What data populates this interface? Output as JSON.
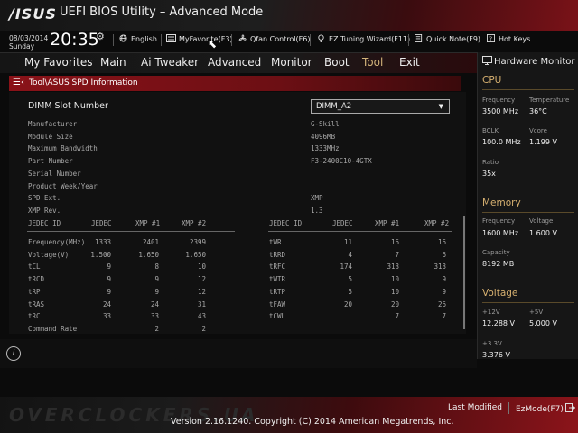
{
  "header": {
    "logo": "/ISUS",
    "title": "UEFI BIOS Utility – Advanced Mode",
    "date": "08/03/2014",
    "day": "Sunday",
    "time": "20:35"
  },
  "toolbar": {
    "language": "English",
    "myfavorite": "MyFavorite(F3)",
    "qfan": "Qfan Control(F6)",
    "ez_tuning": "EZ Tuning Wizard(F11)",
    "quick_note": "Quick Note(F9)",
    "hot_keys": "Hot Keys"
  },
  "menu": {
    "items": [
      "My Favorites",
      "Main",
      "Ai Tweaker",
      "Advanced",
      "Monitor",
      "Boot",
      "Tool",
      "Exit"
    ],
    "active": "Tool"
  },
  "breadcrumb": "Tool\\ASUS SPD Information",
  "spd": {
    "slot_label": "DIMM Slot Number",
    "slot_value": "DIMM_A2",
    "info_labels": [
      "Manufacturer",
      "Module Size",
      "Maximum Bandwidth",
      "Part Number",
      "Serial Number",
      "Product Week/Year",
      "SPD Ext.",
      "XMP Rev."
    ],
    "info_values": [
      "G-Skill",
      "4096MB",
      "1333MHz",
      "F3-2400C10-4GTX",
      "",
      "",
      "XMP",
      "1.3"
    ],
    "left_headers": [
      "JEDEC ID",
      "JEDEC",
      "XMP #1",
      "XMP #2"
    ],
    "right_headers": [
      "JEDEC ID",
      "JEDEC",
      "XMP #1",
      "XMP #2"
    ],
    "left_rows": [
      [
        "Frequency(MHz)",
        "1333",
        "2401",
        "2399"
      ],
      [
        "Voltage(V)",
        "1.500",
        "1.650",
        "1.650"
      ],
      [
        "tCL",
        "9",
        "8",
        "10"
      ],
      [
        "tRCD",
        "9",
        "9",
        "12"
      ],
      [
        "tRP",
        "9",
        "9",
        "12"
      ],
      [
        "tRAS",
        "24",
        "24",
        "31"
      ],
      [
        "tRC",
        "33",
        "33",
        "43"
      ],
      [
        "Command Rate",
        "",
        "2",
        "2"
      ]
    ],
    "right_rows": [
      [
        "tWR",
        "11",
        "16",
        "16"
      ],
      [
        "tRRD",
        "4",
        "7",
        "6"
      ],
      [
        "tRFC",
        "174",
        "313",
        "313"
      ],
      [
        "tWTR",
        "5",
        "10",
        "9"
      ],
      [
        "tRTP",
        "5",
        "10",
        "9"
      ],
      [
        "tFAW",
        "20",
        "20",
        "26"
      ],
      [
        "tCWL",
        "",
        "7",
        "7"
      ]
    ]
  },
  "hw_monitor": {
    "title": "Hardware Monitor",
    "cpu": {
      "heading": "CPU",
      "frequency_label": "Frequency",
      "frequency": "3500 MHz",
      "temperature_label": "Temperature",
      "temperature": "36°C",
      "bclk_label": "BCLK",
      "bclk": "100.0 MHz",
      "vcore_label": "Vcore",
      "vcore": "1.199 V",
      "ratio_label": "Ratio",
      "ratio": "35x"
    },
    "memory": {
      "heading": "Memory",
      "frequency_label": "Frequency",
      "frequency": "1600 MHz",
      "voltage_label": "Voltage",
      "voltage": "1.600 V",
      "capacity_label": "Capacity",
      "capacity": "8192 MB"
    },
    "voltage": {
      "heading": "Voltage",
      "p12_label": "+12V",
      "p12": "12.288 V",
      "p5_label": "+5V",
      "p5": "5.000 V",
      "p33_label": "+3.3V",
      "p33": "3.376 V"
    }
  },
  "footer": {
    "watermark": "OVERCLOCKERS.UA",
    "version": "Version 2.16.1240. Copyright (C) 2014 American Megatrends, Inc.",
    "last_modified": "Last Modified",
    "ezmode": "EzMode(F7)"
  },
  "colors": {
    "accent": "#d2b37a",
    "brand_red": "#8a1218"
  }
}
